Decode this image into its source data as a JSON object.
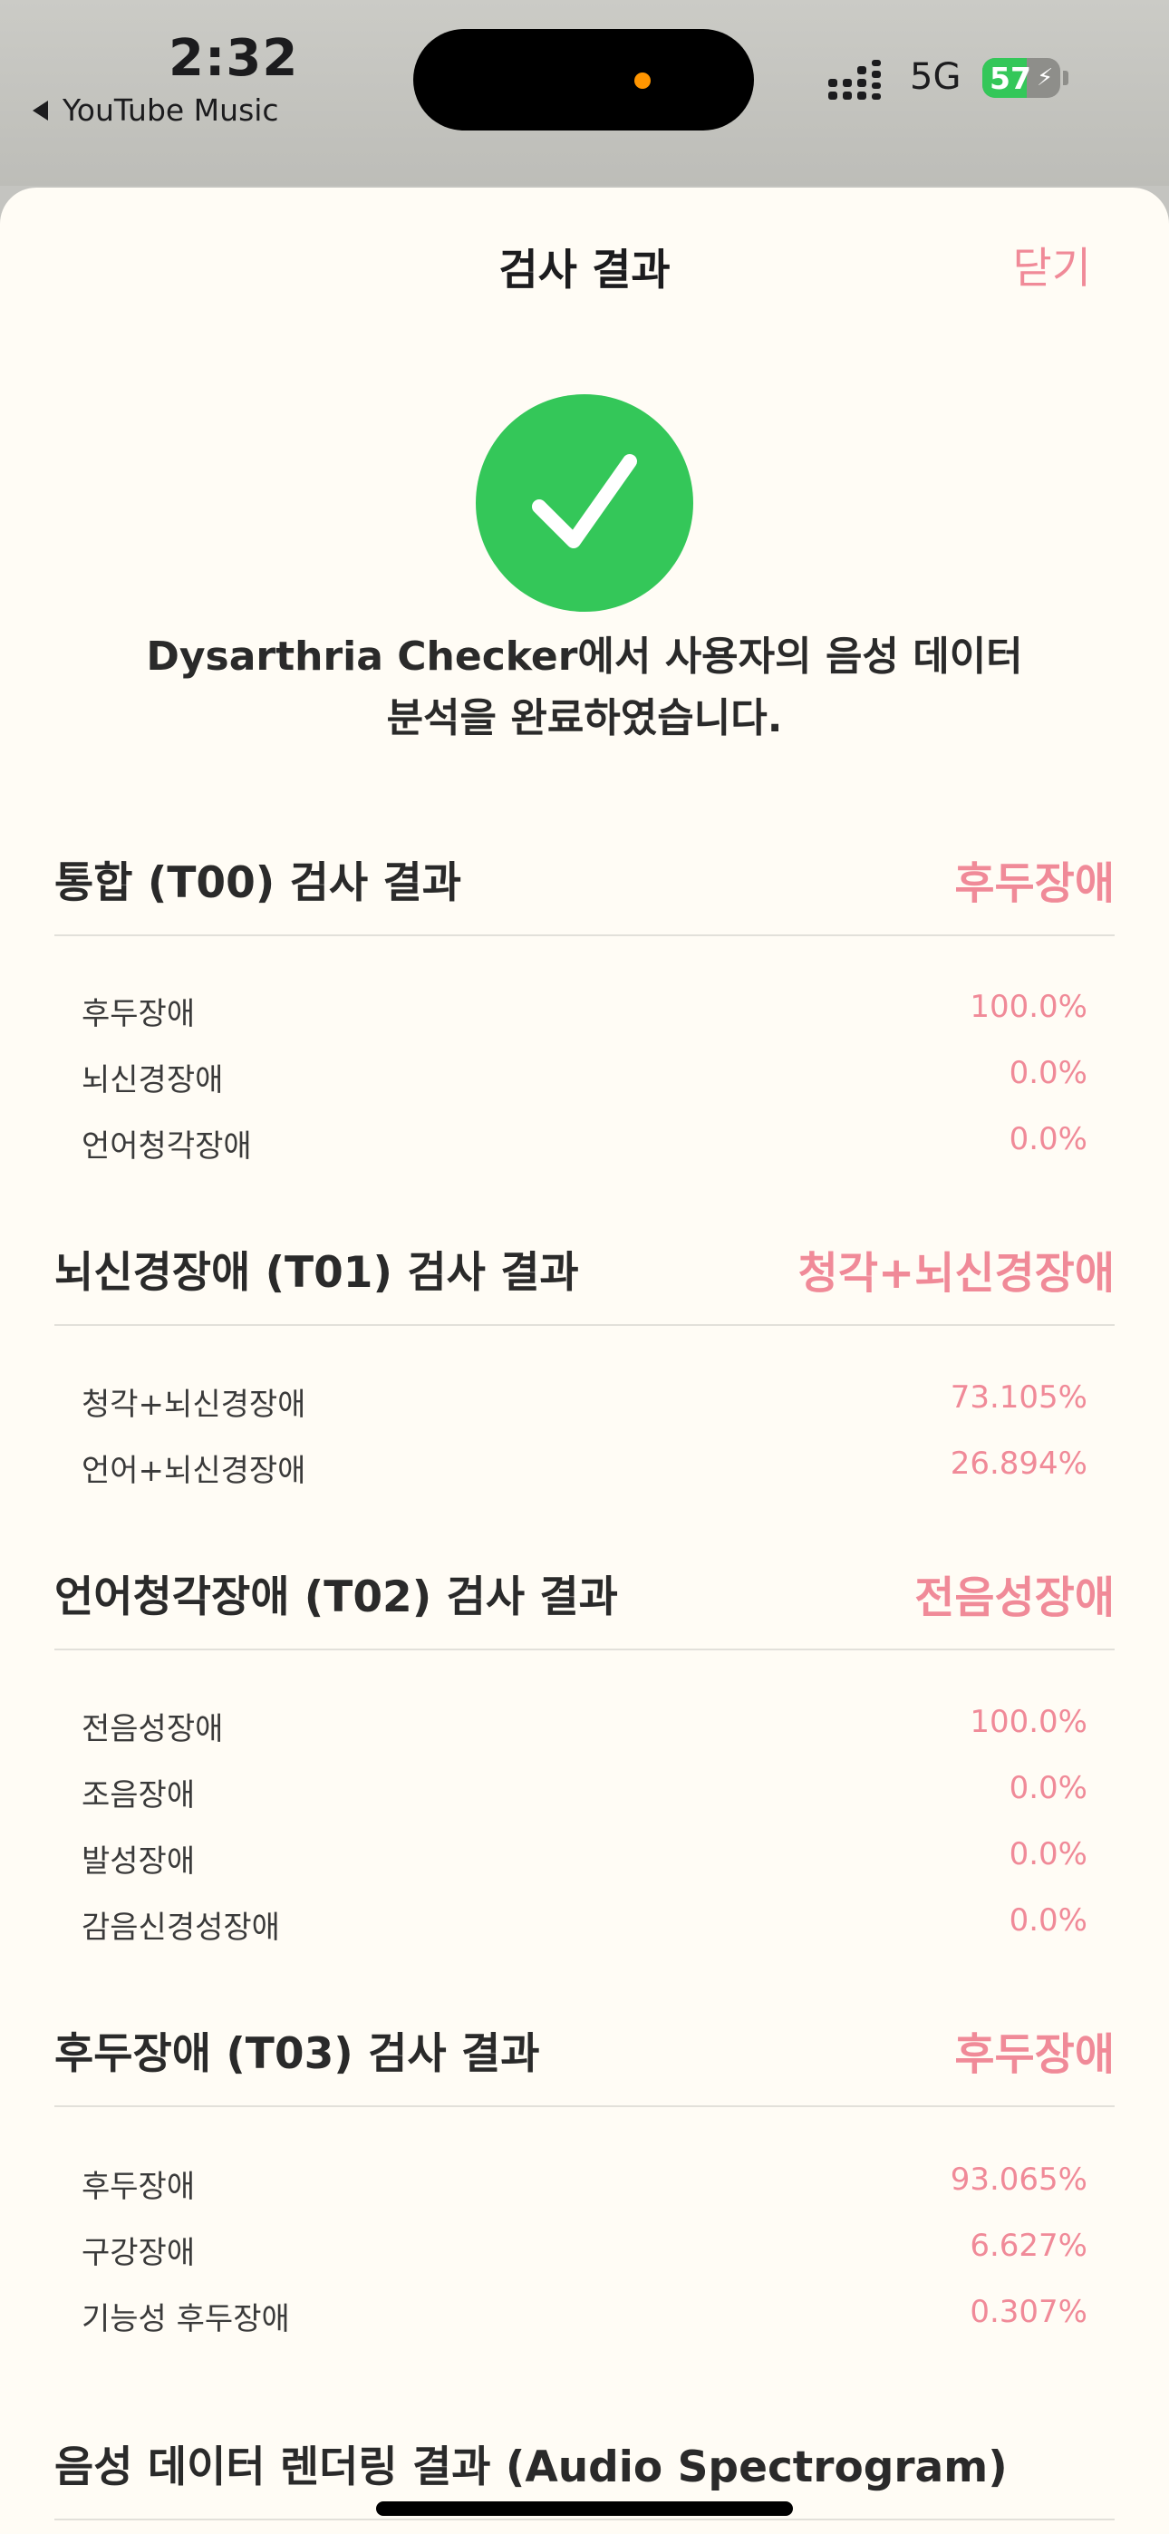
{
  "status_bar": {
    "time": "2:32",
    "back_app": "YouTube Music",
    "network": "5G",
    "battery": "57",
    "battery_level": 0.57,
    "colors": {
      "battery_fill": "#34c759",
      "island_dot": "#ff9500"
    }
  },
  "sheet": {
    "title": "검사 결과",
    "close_label": "닫기",
    "success_icon": "checkmark-circle-icon",
    "message_line1": "Dysarthria Checker에서 사용자의 음성 데이터",
    "message_line2": "분석을 완료하였습니다."
  },
  "sections": [
    {
      "title": "통합 (T00) 검사 결과",
      "result": "후두장애",
      "rows": [
        {
          "label": "후두장애",
          "value": "100.0%"
        },
        {
          "label": "뇌신경장애",
          "value": "0.0%"
        },
        {
          "label": "언어청각장애",
          "value": "0.0%"
        }
      ]
    },
    {
      "title": "뇌신경장애 (T01) 검사 결과",
      "result": "청각+뇌신경장애",
      "rows": [
        {
          "label": "청각+뇌신경장애",
          "value": "73.105%"
        },
        {
          "label": "언어+뇌신경장애",
          "value": "26.894%"
        }
      ]
    },
    {
      "title": "언어청각장애 (T02) 검사 결과",
      "result": "전음성장애",
      "rows": [
        {
          "label": "전음성장애",
          "value": "100.0%"
        },
        {
          "label": "조음장애",
          "value": "0.0%"
        },
        {
          "label": "발성장애",
          "value": "0.0%"
        },
        {
          "label": "감음신경성장애",
          "value": "0.0%"
        }
      ]
    },
    {
      "title": "후두장애 (T03) 검사 결과",
      "result": "후두장애",
      "rows": [
        {
          "label": "후두장애",
          "value": "93.065%"
        },
        {
          "label": "구강장애",
          "value": "6.627%"
        },
        {
          "label": "기능성 후두장애",
          "value": "0.307%"
        }
      ]
    }
  ],
  "spectrogram": {
    "title": "음성 데이터 렌더링 결과 (Audio Spectrogram)"
  },
  "theme": {
    "accent": "#f08a98",
    "success": "#34c759",
    "background": "#fffcf5"
  }
}
